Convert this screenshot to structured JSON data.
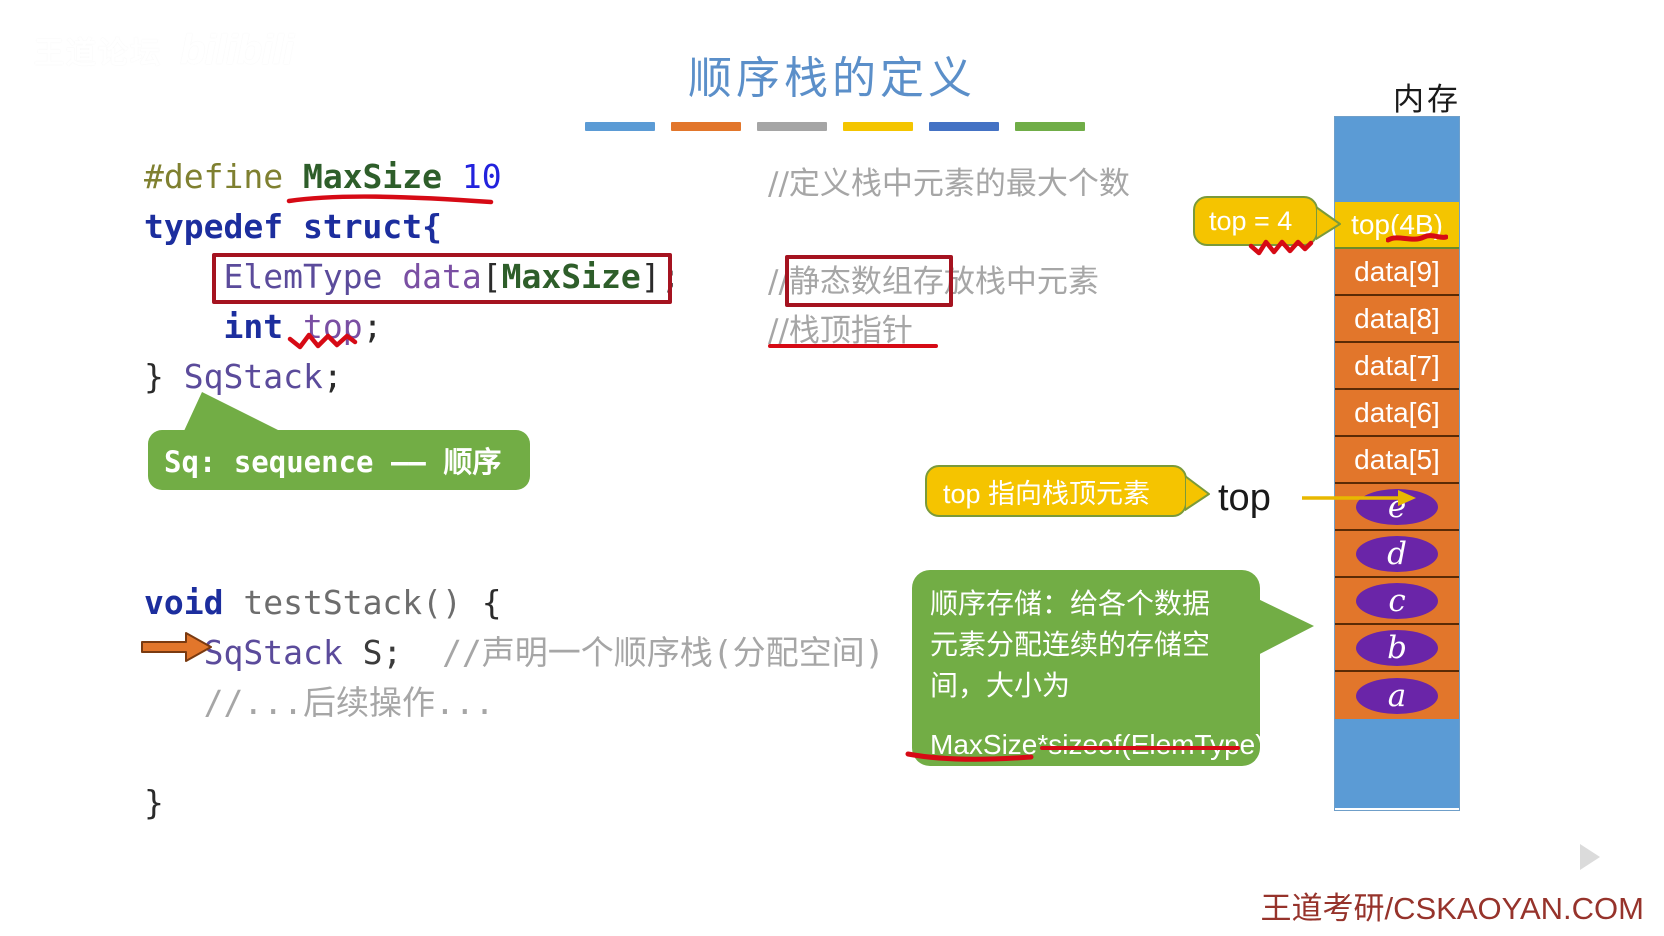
{
  "watermark_topleft": {
    "cn": "王道论坛",
    "bili": "bilibili"
  },
  "title": "顺序栈的定义",
  "title_bar_colors": [
    "#5b9bd5",
    "#e2762b",
    "#a5a5a5",
    "#f4c500",
    "#4472c4",
    "#70ad47"
  ],
  "code_top": {
    "line1": {
      "define": "#define",
      "name": "MaxSize",
      "value": "10"
    },
    "line2": {
      "typedef": "typedef",
      "struct": "struct{"
    },
    "line3": {
      "type": "ElemType",
      "field": "data",
      "lbracket": "[",
      "size": "MaxSize",
      "rbracket": "]",
      "semi": ";"
    },
    "line4": {
      "type": "int",
      "field": "top",
      "semi": ";"
    },
    "line5": {
      "close": "}",
      "name": "SqStack",
      "semi": ";"
    }
  },
  "comments_top": {
    "c1": "//定义栈中元素的最大个数",
    "c2_prefix": "//",
    "c2_boxed": "静态数组",
    "c2_rest": "存放栈中元素",
    "c3": "//栈顶指针"
  },
  "code_bottom": {
    "line1": {
      "ret": "void",
      "fn": "testStack()",
      "brace": "{"
    },
    "line2": {
      "type": "SqStack",
      "var": "S;",
      "comment": "//声明一个顺序栈(分配空间)"
    },
    "line3": {
      "comment": "//...后续操作..."
    },
    "line4": {
      "brace": "}"
    }
  },
  "callouts": {
    "sq": "Sq: sequence —— 顺序",
    "top_eq": "top = 4",
    "top_point": "top 指向栈顶元素",
    "seq_store_text": "顺序存储：给各个数据\n元素分配连续的存储空\n间，大小为",
    "seq_store_formula": "MaxSize*sizeof(ElemType)"
  },
  "memory": {
    "label": "内存",
    "top_label": "top",
    "cells": [
      {
        "kind": "blue",
        "text": ""
      },
      {
        "kind": "yellow",
        "text": "top(4B)"
      },
      {
        "kind": "orange",
        "text": "data[9]"
      },
      {
        "kind": "orange",
        "text": "data[8]"
      },
      {
        "kind": "orange",
        "text": "data[7]"
      },
      {
        "kind": "orange",
        "text": "data[6]"
      },
      {
        "kind": "orange",
        "text": "data[5]"
      },
      {
        "kind": "chip",
        "text": "e"
      },
      {
        "kind": "chip",
        "text": "d"
      },
      {
        "kind": "chip",
        "text": "c"
      },
      {
        "kind": "chip",
        "text": "b"
      },
      {
        "kind": "chip",
        "text": "a"
      },
      {
        "kind": "blue",
        "text": ""
      }
    ]
  },
  "footer": "王道考研/CSKAOYAN.COM",
  "colors": {
    "title": "#5b8fc9",
    "annotation_red": "#d60a15",
    "box_red": "#a51320",
    "callout_green": "#72ad45",
    "callout_yellow": "#f5c400",
    "mem_blue": "#5b9bd5",
    "mem_orange": "#e2762b",
    "mem_yellow": "#f4c500",
    "chip_purple": "#6a25a8",
    "footer": "#96332b"
  }
}
